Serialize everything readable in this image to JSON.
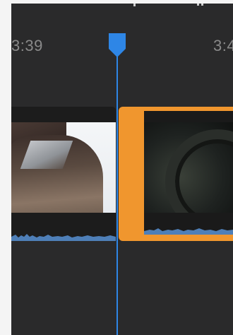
{
  "timeline": {
    "ruler": {
      "left_time": "3:39",
      "right_time": "3:4"
    },
    "top_icons": [
      "left-toolbar-icon",
      "right-toolbar-icon"
    ],
    "clips": [
      {
        "name": "car-clip",
        "thumbnail_icon": "car-thumbnail",
        "selected": false
      },
      {
        "name": "wheel-clip",
        "thumbnail_icon": "wheel-thumbnail",
        "selected": true
      }
    ],
    "playhead": {
      "icon": "playhead-handle-icon"
    }
  },
  "colors": {
    "background": "#2a2a2b",
    "playhead": "#2e86e6",
    "selected_clip": "#f0962e",
    "waveform": "#4e7fb8",
    "ruler_text": "#8a8a8a"
  }
}
